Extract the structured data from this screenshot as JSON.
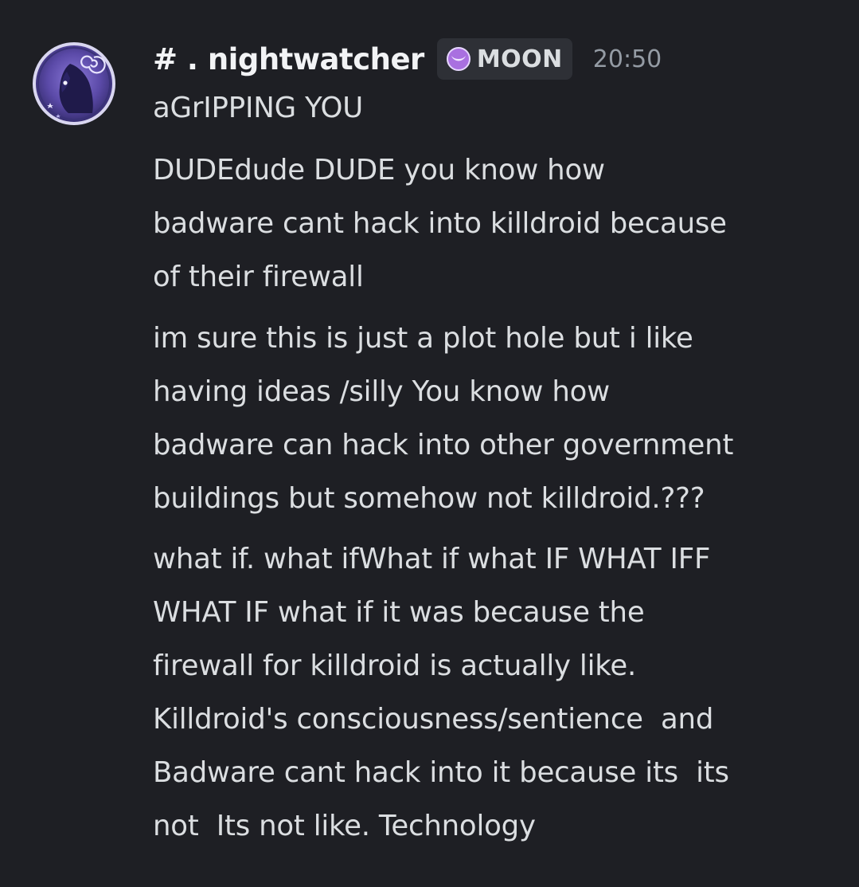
{
  "author": {
    "username": "# . nightwatcher",
    "role_tag": {
      "icon": "crescent-moon-icon",
      "label": "MOON",
      "icon_color": "#a970e0"
    },
    "timestamp": "20:50"
  },
  "colors": {
    "background": "#1e1f24",
    "text": "#dbdee1",
    "username": "#f2f3f5",
    "timestamp": "#949ba4",
    "tag_background": "#2e3036"
  },
  "messages": [
    {
      "lines": [
        "aGrIPPING YOU"
      ]
    },
    {
      "lines": [
        "DUDEdude DUDE you know how",
        "badware cant hack into killdroid because",
        "of their firewall"
      ]
    },
    {
      "lines": [
        "im sure this is just a plot hole but i like",
        "having ideas /silly You know how",
        "badware can hack into other government",
        "buildings but somehow not killdroid.???"
      ]
    },
    {
      "lines": [
        "what if. what ifWhat if what IF WHAT IFF",
        "WHAT IF what if it was because the",
        "firewall for killdroid is actually like.",
        "Killdroid's consciousness/sentience  and",
        "Badware cant hack into it because its  its",
        "not  Its not like. Technology"
      ]
    }
  ]
}
